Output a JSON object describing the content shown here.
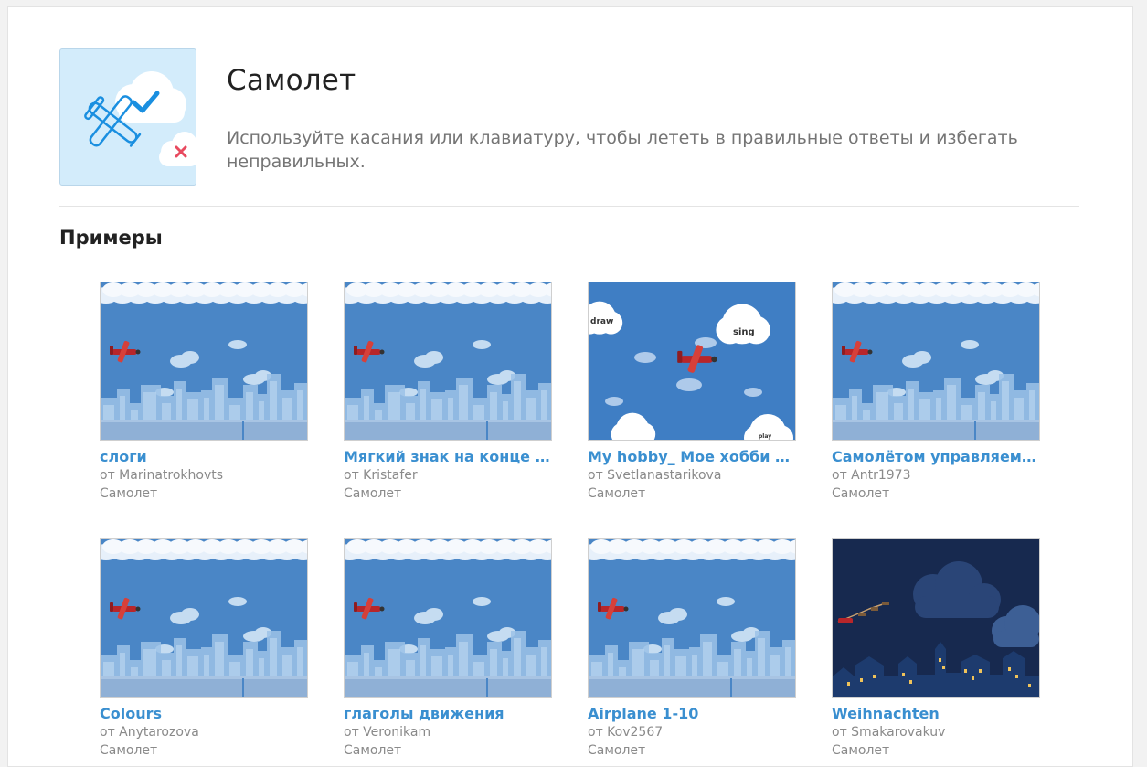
{
  "header": {
    "title": "Самолет",
    "description": "Используйте касания или клавиатуру, чтобы лететь в правильные ответы и избегать неправильных.",
    "icon": "airplane-clouds-icon"
  },
  "examples": {
    "heading": "Примеры",
    "items": [
      {
        "title": "слоги",
        "author": "от Marinatrokhovts",
        "template": "Самолет",
        "scene": "city"
      },
      {
        "title": "Мягкий знак на конце су...",
        "author": "от Kristafer",
        "template": "Самолет",
        "scene": "city"
      },
      {
        "title": "My hobby_ Мое хобби (иг...",
        "author": "от Svetlanastarikova",
        "template": "Самолет",
        "scene": "clouds",
        "cloud_words": [
          "draw",
          "sing",
          "play"
        ]
      },
      {
        "title": "Самолётом управляем - п...",
        "author": "от Antr1973",
        "template": "Самолет",
        "scene": "city"
      },
      {
        "title": "Colours",
        "author": "от Anytarozova",
        "template": "Самолет",
        "scene": "city"
      },
      {
        "title": "глаголы движения",
        "author": "от Veronikam",
        "template": "Самолет",
        "scene": "city"
      },
      {
        "title": "Airplane 1-10",
        "author": "от Kov2567",
        "template": "Самолет",
        "scene": "city"
      },
      {
        "title": "Weihnachten",
        "author": "от Smakarovakuv",
        "template": "Самолет",
        "scene": "night"
      }
    ]
  },
  "colors": {
    "link": "#3a8fd0",
    "sky": "#4a86c6",
    "night_sky": "#17294f",
    "icon_bg": "#d3ecfb",
    "check": "#1a8fe0",
    "cross": "#e84a5f"
  }
}
